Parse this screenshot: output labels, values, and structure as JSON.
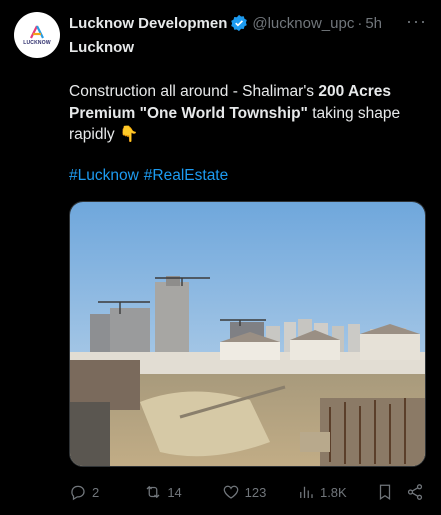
{
  "tweet": {
    "avatar_text": "LUCKNOW",
    "author_name": "Lucknow Developmen",
    "handle": "@lucknow_upc",
    "separator": "·",
    "time": "5h",
    "more": "···",
    "subtitle": "Lucknow",
    "text_plain_1": "Construction all around - Shalimar's ",
    "text_bold": "200 Acres Premium \"One World Township\"",
    "text_plain_2": " taking shape rapidly ",
    "emoji": "👇",
    "hashtags": [
      "#Lucknow",
      "#RealEstate"
    ],
    "media_description_colors": {
      "sky": "#9ec3e8",
      "ground": "#b9a98a"
    },
    "actions": {
      "replies": "2",
      "retweets": "14",
      "likes": "123",
      "views": "1.8K"
    },
    "colors": {
      "accent": "#1d9bf0",
      "muted": "#71767b",
      "text": "#e7e9ea",
      "background": "#000000"
    }
  }
}
